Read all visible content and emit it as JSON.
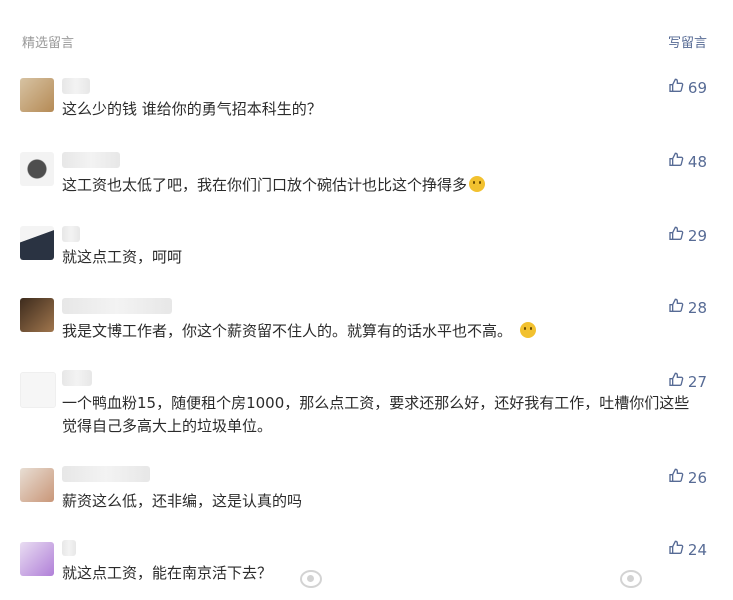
{
  "header": {
    "left_label": "精选留言",
    "right_label": "写留言"
  },
  "comments": [
    {
      "nickname": "",
      "text": "这么少的钱 谁给你的勇气招本科生的？",
      "likes": "69",
      "emoji": false
    },
    {
      "nickname": "",
      "text": "这工资也太低了吧，我在你们门口放个碗估计也比这个挣得多",
      "likes": "48",
      "emoji": true
    },
    {
      "nickname": "",
      "text": "就这点工资，呵呵",
      "likes": "29",
      "emoji": false
    },
    {
      "nickname": "",
      "text": "我是文博工作者，你这个薪资留不住人的。就算有的话水平也不高。",
      "likes": "28",
      "emoji": true
    },
    {
      "nickname": "",
      "text": "一个鸭血粉15，随便租个房1000，那么点工资，要求还那么好，还好我有工作，吐槽你们这些觉得自己多高大上的垃圾单位。",
      "likes": "27",
      "emoji": false
    },
    {
      "nickname": "",
      "text": "薪资这么低，还非编，这是认真的吗",
      "likes": "26",
      "emoji": false
    },
    {
      "nickname": "",
      "text": "就这点工资，能在南京活下去？",
      "likes": "24",
      "emoji": false
    }
  ],
  "icons": {
    "like": "thumbs-up-icon"
  },
  "colors": {
    "link": "#576b95",
    "meta": "#9a9a9a"
  }
}
